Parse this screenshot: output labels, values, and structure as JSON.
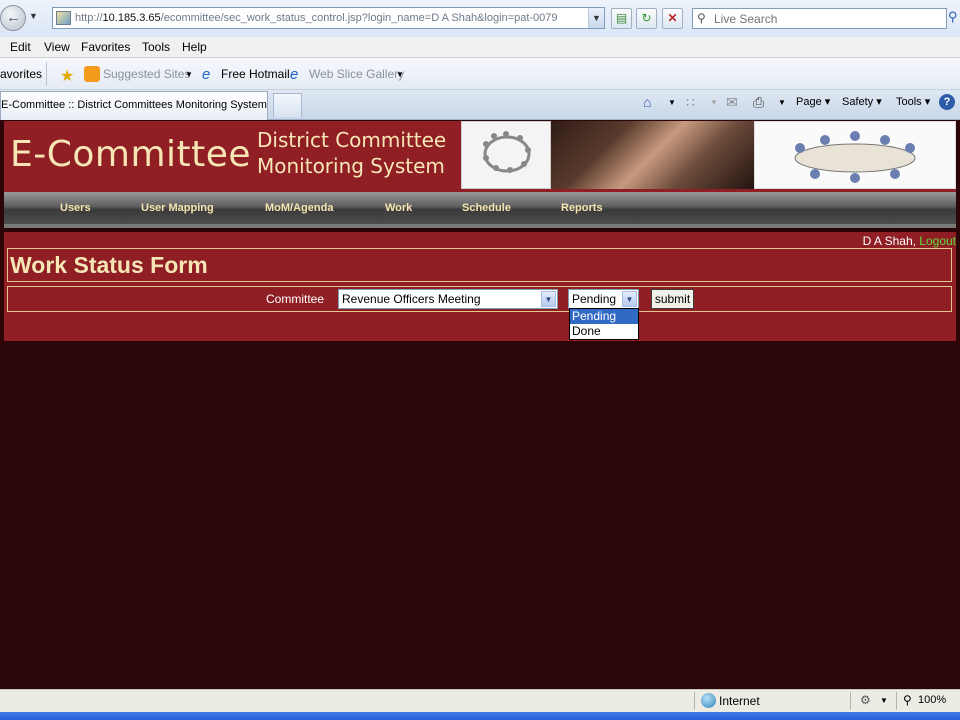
{
  "browser": {
    "url_prefix": "http://",
    "url_host": "10.185.3.65",
    "url_path": "/ecommittee/sec_work_status_control.jsp?login_name=D A Shah&login=pat-0079",
    "search_placeholder": "Live Search",
    "menu": [
      "Edit",
      "View",
      "Favorites",
      "Tools",
      "Help"
    ],
    "favorites_label": "avorites",
    "suggested_sites": "Suggested Sites",
    "free_hotmail": "Free Hotmail",
    "web_slice_gallery": "Web Slice Gallery",
    "tab_title": "E-Committee :: District Committees Monitoring System",
    "commands": {
      "page": "Page",
      "safety": "Safety",
      "tools": "Tools"
    },
    "status_zone": "Internet",
    "zoom": "100%"
  },
  "site": {
    "logo": "E-Committee",
    "subtitle_line1": "District Committee",
    "subtitle_line2": "Monitoring System",
    "nav": [
      "Users",
      "User Mapping",
      "MoM/Agenda",
      "Work",
      "Schedule",
      "Reports"
    ]
  },
  "user": {
    "name": "D A Shah,",
    "logout": "Logout"
  },
  "form": {
    "title": "Work Status Form",
    "committee_label": "Committee",
    "committee_value": "Revenue Officers Meeting",
    "status_value": "Pending",
    "status_options": [
      "Pending",
      "Done"
    ],
    "submit_label": "submit"
  },
  "colors": {
    "page_background": "#2b0507",
    "banner": "#8f1f25",
    "cream_text": "#f7e6b5",
    "logout_link": "#5edc3a"
  }
}
